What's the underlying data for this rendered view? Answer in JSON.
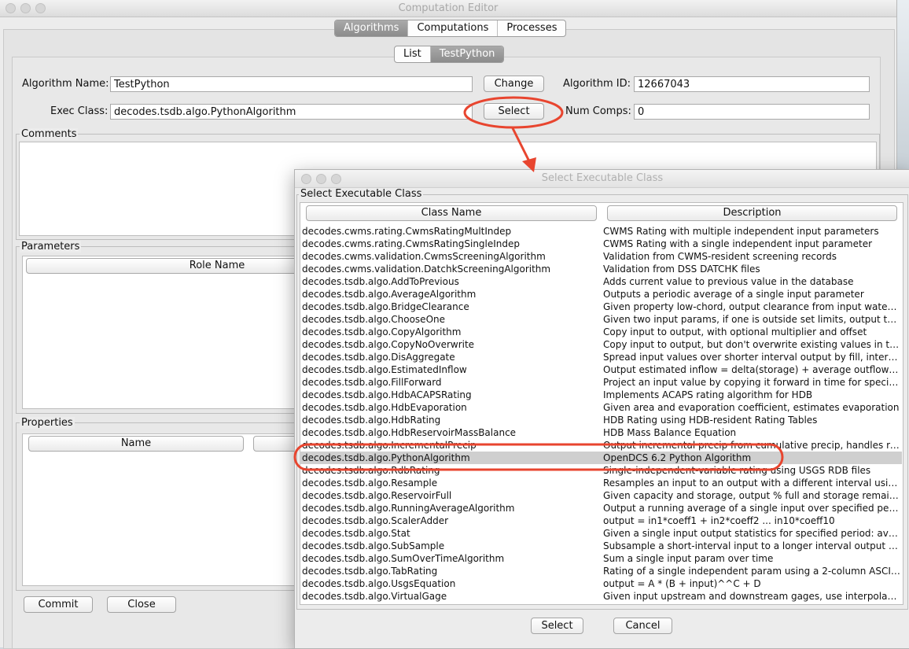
{
  "window": {
    "title": "Computation Editor"
  },
  "top_tabs": [
    "Algorithms",
    "Computations",
    "Processes"
  ],
  "sub_tabs": [
    "List",
    "TestPython"
  ],
  "form": {
    "algo_name_label": "Algorithm Name:",
    "algo_name_value": "TestPython",
    "change_label": "Change",
    "algo_id_label": "Algorithm ID:",
    "algo_id_value": "12667043",
    "exec_class_label": "Exec Class:",
    "exec_class_value": "decodes.tsdb.algo.PythonAlgorithm",
    "select_label": "Select",
    "num_comps_label": "Num Comps:",
    "num_comps_value": "0"
  },
  "comments": {
    "title": "Comments"
  },
  "parameters": {
    "title": "Parameters",
    "col_role": "Role Name"
  },
  "properties": {
    "title": "Properties",
    "col_name": "Name"
  },
  "bottom": {
    "commit_label": "Commit",
    "close_label": "Close"
  },
  "dialog": {
    "title": "Select Executable Class",
    "group_title": "Select Executable Class",
    "col_class": "Class Name",
    "col_desc": "Description",
    "select_label": "Select",
    "cancel_label": "Cancel",
    "rows": [
      {
        "cls": "decodes.cwms.rating.CwmsRatingMultIndep",
        "desc": "CWMS Rating with multiple independent input parameters"
      },
      {
        "cls": "decodes.cwms.rating.CwmsRatingSingleIndep",
        "desc": "CWMS Rating with a single independent input parameter"
      },
      {
        "cls": "decodes.cwms.validation.CwmsScreeningAlgorithm",
        "desc": "Validation from CWMS-resident screening records"
      },
      {
        "cls": "decodes.cwms.validation.DatchkScreeningAlgorithm",
        "desc": "Validation from DSS DATCHK files"
      },
      {
        "cls": "decodes.tsdb.algo.AddToPrevious",
        "desc": "Adds current value to previous value in the database"
      },
      {
        "cls": "decodes.tsdb.algo.AverageAlgorithm",
        "desc": "Outputs a periodic average of a single input parameter"
      },
      {
        "cls": "decodes.tsdb.algo.BridgeClearance",
        "desc": "Given property low-chord, output clearance from input waterLe..."
      },
      {
        "cls": "decodes.tsdb.algo.ChooseOne",
        "desc": "Given two input params, if one is outside set limits, output the ..."
      },
      {
        "cls": "decodes.tsdb.algo.CopyAlgorithm",
        "desc": "Copy input to output, with optional multiplier and offset"
      },
      {
        "cls": "decodes.tsdb.algo.CopyNoOverwrite",
        "desc": "Copy input to output, but don't overwrite existing values in the ..."
      },
      {
        "cls": "decodes.tsdb.algo.DisAggregate",
        "desc": "Spread input values over shorter interval output by fill, interpol..."
      },
      {
        "cls": "decodes.tsdb.algo.EstimatedInflow",
        "desc": "Output estimated inflow = delta(storage) + average outflow ov..."
      },
      {
        "cls": "decodes.tsdb.algo.FillForward",
        "desc": "Project an input value by copying it forward in time for specifie..."
      },
      {
        "cls": "decodes.tsdb.algo.HdbACAPSRating",
        "desc": "Implements ACAPS rating algorithm for HDB"
      },
      {
        "cls": "decodes.tsdb.algo.HdbEvaporation",
        "desc": "Given area and evaporation coefficient, estimates evaporation"
      },
      {
        "cls": "decodes.tsdb.algo.HdbRating",
        "desc": "HDB Rating using HDB-resident Rating Tables"
      },
      {
        "cls": "decodes.tsdb.algo.HdbReservoirMassBalance",
        "desc": "HDB Mass Balance Equation"
      },
      {
        "cls": "decodes.tsdb.algo.IncrementalPrecip",
        "desc": "Output incremental precip from cumulative precip, handles reset."
      },
      {
        "cls": "decodes.tsdb.algo.PythonAlgorithm",
        "desc": "OpenDCS 6.2 Python Algorithm"
      },
      {
        "cls": "decodes.tsdb.algo.RdbRating",
        "desc": "Single-independent-variable rating using USGS RDB files"
      },
      {
        "cls": "decodes.tsdb.algo.Resample",
        "desc": "Resamples an input to an output with a different interval using i..."
      },
      {
        "cls": "decodes.tsdb.algo.ReservoirFull",
        "desc": "Given capacity and storage, output % full and storage remaining"
      },
      {
        "cls": "decodes.tsdb.algo.RunningAverageAlgorithm",
        "desc": "Output a running average of a single input over specified period."
      },
      {
        "cls": "decodes.tsdb.algo.ScalerAdder",
        "desc": "output = in1*coeff1 + in2*coeff2 ... in10*coeff10"
      },
      {
        "cls": "decodes.tsdb.algo.Stat",
        "desc": "Given a single input output statistics for specified period: avera..."
      },
      {
        "cls": "decodes.tsdb.algo.SubSample",
        "desc": "Subsample a short-interval input to a longer interval output by ..."
      },
      {
        "cls": "decodes.tsdb.algo.SumOverTimeAlgorithm",
        "desc": "Sum a single input param over time"
      },
      {
        "cls": "decodes.tsdb.algo.TabRating",
        "desc": "Rating of a single independent param using a 2-column ASCII fi..."
      },
      {
        "cls": "decodes.tsdb.algo.UsgsEquation",
        "desc": "output = A * (B + input)^^C + D"
      },
      {
        "cls": "decodes.tsdb.algo.VirtualGage",
        "desc": "Given input upstream and downstream gages, use interpolation..."
      }
    ],
    "selected_index": 18
  },
  "annotation": {
    "color": "#e8452f"
  }
}
